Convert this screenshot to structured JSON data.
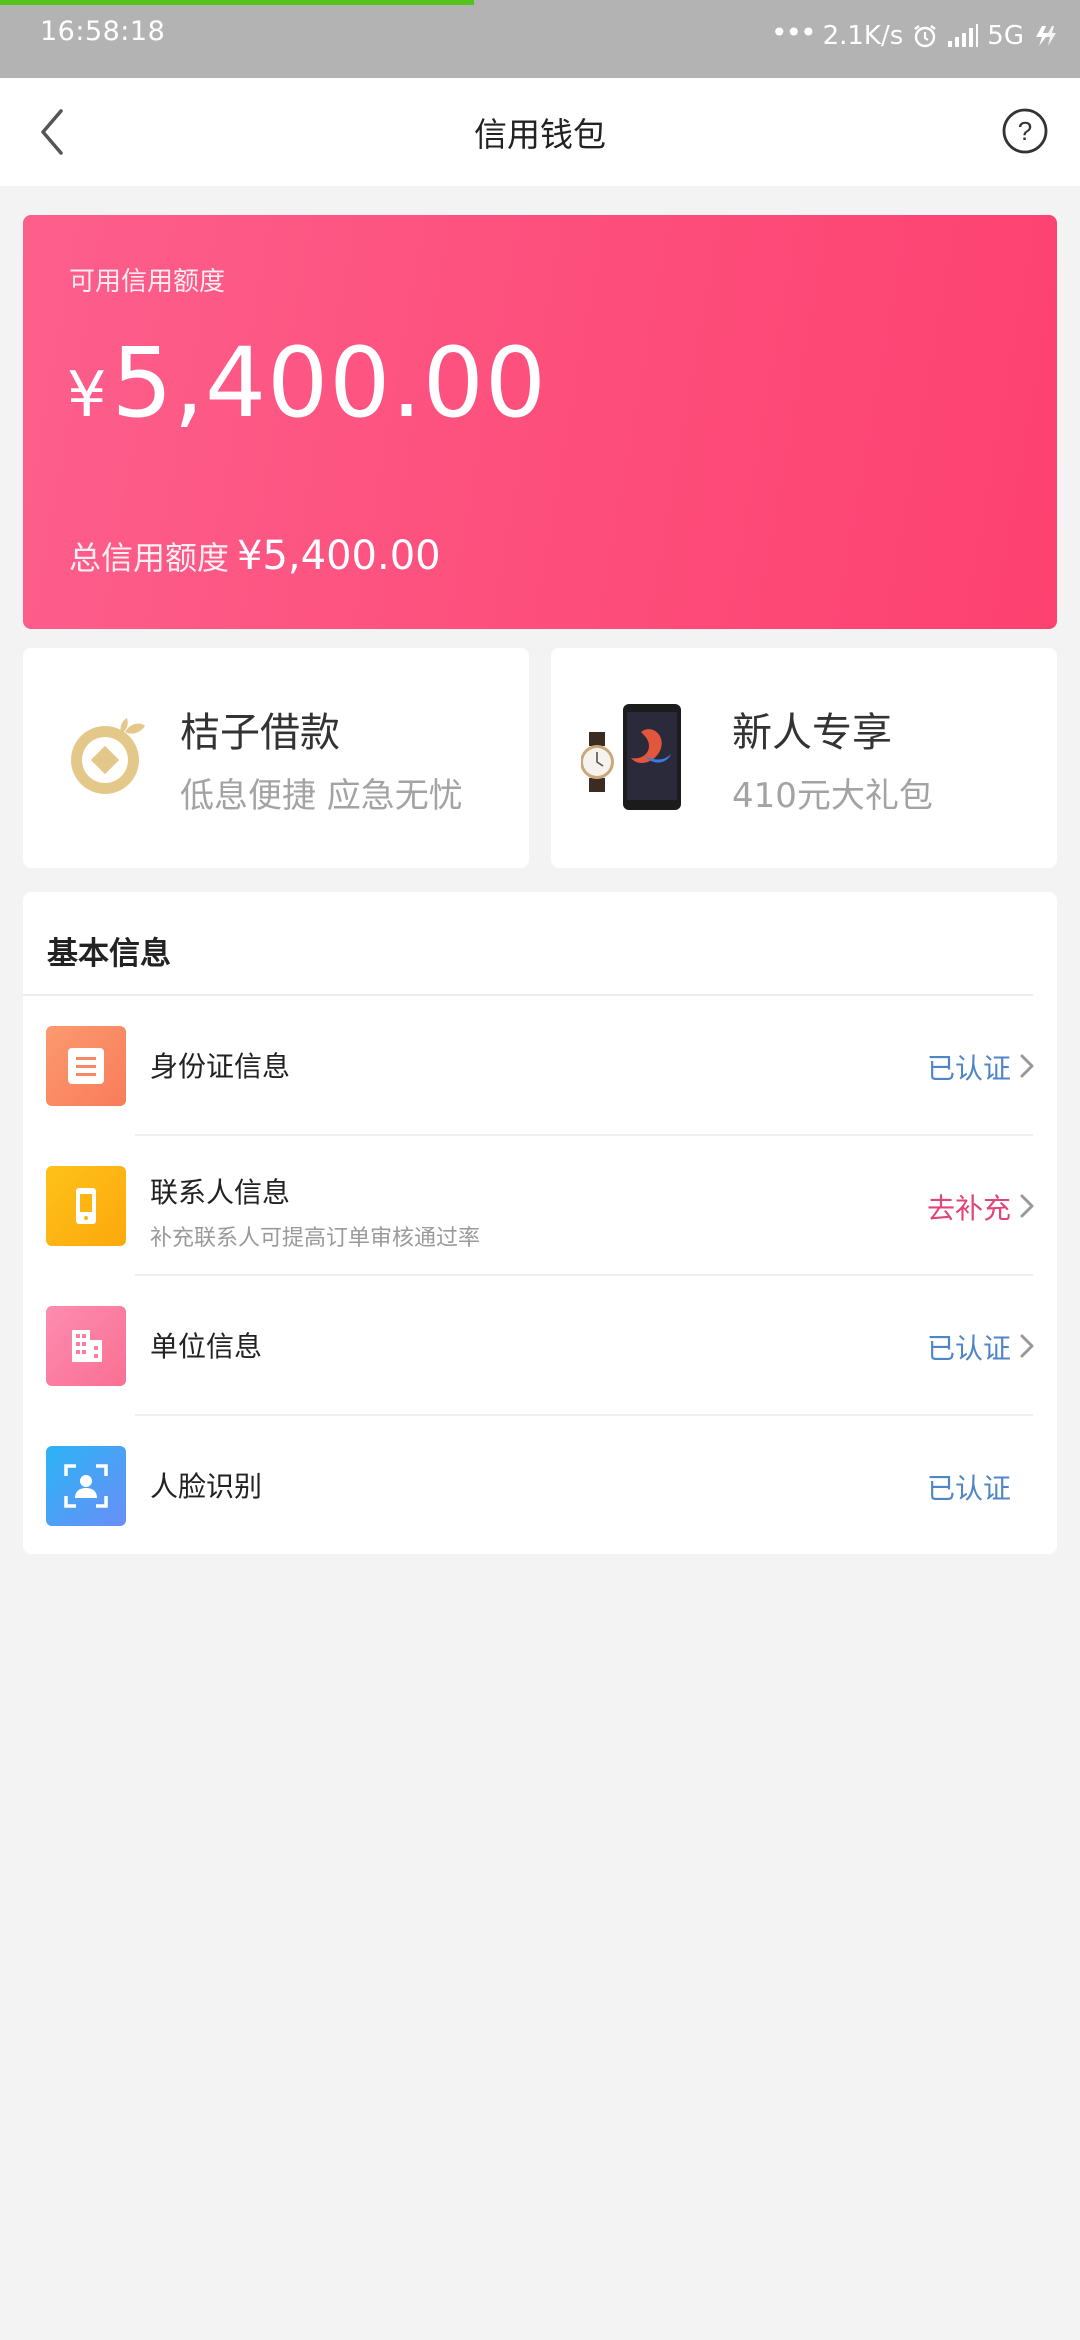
{
  "status_bar": {
    "time": "16:58:18",
    "network_speed": "2.1K/s",
    "network_type": "5G",
    "icons": [
      "more-dots-icon",
      "alarm-icon",
      "signal-icon",
      "5g-icon",
      "charging-icon"
    ]
  },
  "header": {
    "title": "信用钱包",
    "back_icon": "chevron-left-icon",
    "help_icon": "help-circle-icon"
  },
  "credit": {
    "available_label": "可用信用额度",
    "currency_symbol": "¥",
    "available_amount": "5,400.00",
    "total_label": "总信用额度",
    "total_amount": "¥5,400.00",
    "gradient_start": "#fd5f8d",
    "gradient_end": "#fd4170"
  },
  "promos": [
    {
      "title": "桔子借款",
      "subtitle": "低息便捷  应急无忧",
      "icon": "coin-icon"
    },
    {
      "title": "新人专享",
      "subtitle": "410元大礼包",
      "icon": "watch-phone-icon"
    }
  ],
  "info": {
    "header": "基本信息",
    "rows": [
      {
        "label": "身份证信息",
        "subtitle": "",
        "status": "已认证",
        "status_type": "verified",
        "icon": "id-card-icon",
        "icon_color": "#fa8a62",
        "has_chevron": true
      },
      {
        "label": "联系人信息",
        "subtitle": "补充联系人可提高订单审核通过率",
        "status": "去补充",
        "status_type": "action",
        "icon": "phone-icon",
        "icon_color": "#fdb512",
        "has_chevron": true
      },
      {
        "label": "单位信息",
        "subtitle": "",
        "status": "已认证",
        "status_type": "verified",
        "icon": "building-icon",
        "icon_color": "#fb7ea0",
        "has_chevron": true
      },
      {
        "label": "人脸识别",
        "subtitle": "",
        "status": "已认证",
        "status_type": "verified",
        "icon": "face-scan-icon",
        "icon_color": "#3aa4f6",
        "has_chevron": false
      }
    ]
  },
  "colors": {
    "verified": "#4f86c8",
    "action": "#e0457b",
    "status_bar_progress": "#55c31b"
  }
}
